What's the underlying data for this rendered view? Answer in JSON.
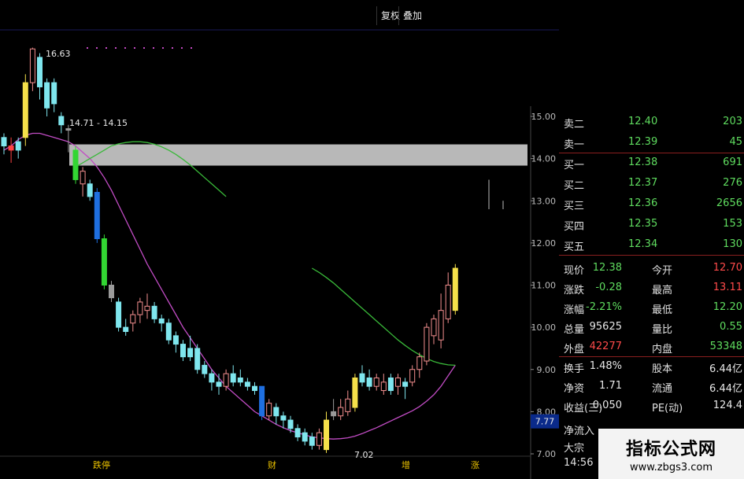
{
  "toolbar": {
    "fuquan_label": "复权",
    "diejia_label": "叠加"
  },
  "chart_data": {
    "type": "candlestick",
    "price_axis": {
      "ticks": [
        "15.00",
        "14.00",
        "13.00",
        "12.00",
        "11.00",
        "10.00",
        "9.00",
        "8.00",
        "7.00"
      ],
      "min": 6.8,
      "max": 15.2
    },
    "current_price_marker": "7.77",
    "annotations": {
      "high": "16.63",
      "zone": "14.71 - 14.15",
      "low": "7.02"
    },
    "resistance_zone": {
      "top": 14.71,
      "bottom": 14.15
    },
    "bottom_labels": [
      "跌停",
      "财",
      "增",
      "涨"
    ],
    "candles": [
      {
        "o": 14.3,
        "c": 14.5,
        "h": 14.6,
        "l": 14.1,
        "col": "cyan"
      },
      {
        "o": 14.2,
        "c": 14.3,
        "h": 14.5,
        "l": 13.9,
        "col": "red"
      },
      {
        "o": 14.4,
        "c": 14.2,
        "h": 14.5,
        "l": 14.0,
        "col": "cyan"
      },
      {
        "o": 14.5,
        "c": 15.8,
        "h": 16.0,
        "l": 14.3,
        "col": "yellow"
      },
      {
        "o": 15.8,
        "c": 16.6,
        "h": 16.63,
        "l": 15.6,
        "col": "pink"
      },
      {
        "o": 16.4,
        "c": 15.7,
        "h": 16.5,
        "l": 15.4,
        "col": "cyan"
      },
      {
        "o": 15.8,
        "c": 15.2,
        "h": 15.9,
        "l": 15.0,
        "col": "cyan"
      },
      {
        "o": 15.3,
        "c": 15.8,
        "h": 15.9,
        "l": 15.1,
        "col": "cyan"
      },
      {
        "o": 15.0,
        "c": 14.8,
        "h": 15.1,
        "l": 14.6,
        "col": "cyan"
      },
      {
        "o": 14.71,
        "c": 14.71,
        "h": 14.8,
        "l": 14.15,
        "col": "grey"
      },
      {
        "o": 14.2,
        "c": 13.5,
        "h": 14.3,
        "l": 13.4,
        "col": "green"
      },
      {
        "o": 13.4,
        "c": 13.7,
        "h": 13.8,
        "l": 13.1,
        "col": "pink"
      },
      {
        "o": 13.4,
        "c": 13.1,
        "h": 13.5,
        "l": 13.0,
        "col": "cyan"
      },
      {
        "o": 13.2,
        "c": 12.1,
        "h": 13.3,
        "l": 12.0,
        "col": "blue"
      },
      {
        "o": 12.1,
        "c": 11.0,
        "h": 12.2,
        "l": 10.9,
        "col": "green"
      },
      {
        "o": 11.0,
        "c": 10.7,
        "h": 11.1,
        "l": 10.6,
        "col": "grey"
      },
      {
        "o": 10.6,
        "c": 10.0,
        "h": 10.7,
        "l": 9.9,
        "col": "cyan"
      },
      {
        "o": 10.0,
        "c": 9.9,
        "h": 10.2,
        "l": 9.8,
        "col": "cyan"
      },
      {
        "o": 10.1,
        "c": 10.3,
        "h": 10.4,
        "l": 9.9,
        "col": "pink"
      },
      {
        "o": 10.3,
        "c": 10.6,
        "h": 10.7,
        "l": 10.1,
        "col": "pink"
      },
      {
        "o": 10.5,
        "c": 10.4,
        "h": 10.8,
        "l": 10.2,
        "col": "pink"
      },
      {
        "o": 10.5,
        "c": 10.2,
        "h": 10.6,
        "l": 10.1,
        "col": "cyan"
      },
      {
        "o": 10.2,
        "c": 10.1,
        "h": 10.3,
        "l": 9.9,
        "col": "cyan"
      },
      {
        "o": 10.1,
        "c": 9.7,
        "h": 10.2,
        "l": 9.6,
        "col": "cyan"
      },
      {
        "o": 9.8,
        "c": 9.6,
        "h": 9.9,
        "l": 9.4,
        "col": "cyan"
      },
      {
        "o": 9.6,
        "c": 9.3,
        "h": 9.7,
        "l": 9.2,
        "col": "cyan"
      },
      {
        "o": 9.5,
        "c": 9.3,
        "h": 9.8,
        "l": 9.2,
        "col": "cyan"
      },
      {
        "o": 9.5,
        "c": 9.0,
        "h": 9.6,
        "l": 8.9,
        "col": "cyan"
      },
      {
        "o": 9.1,
        "c": 8.9,
        "h": 9.2,
        "l": 8.8,
        "col": "cyan"
      },
      {
        "o": 8.9,
        "c": 8.7,
        "h": 9.0,
        "l": 8.5,
        "col": "cyan"
      },
      {
        "o": 8.7,
        "c": 8.6,
        "h": 8.9,
        "l": 8.4,
        "col": "cyan"
      },
      {
        "o": 8.6,
        "c": 8.9,
        "h": 9.0,
        "l": 8.5,
        "col": "pink"
      },
      {
        "o": 8.9,
        "c": 8.7,
        "h": 9.1,
        "l": 8.6,
        "col": "cyan"
      },
      {
        "o": 8.8,
        "c": 8.7,
        "h": 9.0,
        "l": 8.6,
        "col": "cyan"
      },
      {
        "o": 8.7,
        "c": 8.6,
        "h": 8.8,
        "l": 8.5,
        "col": "cyan"
      },
      {
        "o": 8.6,
        "c": 8.5,
        "h": 8.7,
        "l": 8.4,
        "col": "cyan"
      },
      {
        "o": 8.6,
        "c": 7.9,
        "h": 8.6,
        "l": 7.8,
        "col": "blue"
      },
      {
        "o": 7.9,
        "c": 8.2,
        "h": 8.3,
        "l": 7.8,
        "col": "pink"
      },
      {
        "o": 8.1,
        "c": 7.9,
        "h": 8.2,
        "l": 7.7,
        "col": "cyan"
      },
      {
        "o": 7.9,
        "c": 7.8,
        "h": 8.0,
        "l": 7.6,
        "col": "cyan"
      },
      {
        "o": 7.8,
        "c": 7.6,
        "h": 7.9,
        "l": 7.5,
        "col": "cyan"
      },
      {
        "o": 7.6,
        "c": 7.4,
        "h": 7.7,
        "l": 7.3,
        "col": "cyan"
      },
      {
        "o": 7.5,
        "c": 7.3,
        "h": 7.6,
        "l": 7.2,
        "col": "cyan"
      },
      {
        "o": 7.4,
        "c": 7.2,
        "h": 7.5,
        "l": 7.1,
        "col": "cyan"
      },
      {
        "o": 7.2,
        "c": 7.5,
        "h": 7.6,
        "l": 7.1,
        "col": "pink"
      },
      {
        "o": 7.1,
        "c": 7.8,
        "h": 8.0,
        "l": 7.02,
        "col": "yellow"
      },
      {
        "o": 7.9,
        "c": 8.0,
        "h": 8.3,
        "l": 7.8,
        "col": "grey"
      },
      {
        "o": 7.9,
        "c": 8.1,
        "h": 8.3,
        "l": 7.8,
        "col": "pink"
      },
      {
        "o": 8.0,
        "c": 8.3,
        "h": 8.5,
        "l": 7.9,
        "col": "pink"
      },
      {
        "o": 8.1,
        "c": 8.8,
        "h": 8.9,
        "l": 8.0,
        "col": "yellow"
      },
      {
        "o": 8.7,
        "c": 8.9,
        "h": 9.1,
        "l": 8.6,
        "col": "cyan"
      },
      {
        "o": 8.8,
        "c": 8.6,
        "h": 9.0,
        "l": 8.5,
        "col": "cyan"
      },
      {
        "o": 8.6,
        "c": 8.8,
        "h": 8.9,
        "l": 8.5,
        "col": "pink"
      },
      {
        "o": 8.7,
        "c": 8.5,
        "h": 8.9,
        "l": 8.4,
        "col": "pink"
      },
      {
        "o": 8.5,
        "c": 8.8,
        "h": 8.9,
        "l": 8.4,
        "col": "cyan"
      },
      {
        "o": 8.8,
        "c": 8.6,
        "h": 8.9,
        "l": 8.4,
        "col": "pink"
      },
      {
        "o": 8.6,
        "c": 8.7,
        "h": 8.8,
        "l": 8.3,
        "col": "cyan"
      },
      {
        "o": 8.7,
        "c": 9.0,
        "h": 9.1,
        "l": 8.6,
        "col": "pink"
      },
      {
        "o": 9.0,
        "c": 9.3,
        "h": 9.4,
        "l": 8.8,
        "col": "pink"
      },
      {
        "o": 9.2,
        "c": 10.0,
        "h": 10.1,
        "l": 9.1,
        "col": "pink"
      },
      {
        "o": 9.8,
        "c": 10.2,
        "h": 10.3,
        "l": 9.6,
        "col": "pink"
      },
      {
        "o": 9.7,
        "c": 10.4,
        "h": 10.8,
        "l": 9.5,
        "col": "pink"
      },
      {
        "o": 10.2,
        "c": 11.0,
        "h": 11.3,
        "l": 10.1,
        "col": "pink"
      },
      {
        "o": 10.4,
        "c": 11.4,
        "h": 11.5,
        "l": 10.3,
        "col": "yellow"
      }
    ],
    "ma_purple": [
      14.2,
      14.3,
      14.45,
      14.55,
      14.6,
      14.6,
      14.55,
      14.5,
      14.45,
      14.4,
      14.3,
      14.15,
      14.0,
      13.8,
      13.55,
      13.25,
      12.9,
      12.55,
      12.2,
      11.85,
      11.5,
      11.2,
      10.9,
      10.6,
      10.3,
      10.0,
      9.75,
      9.5,
      9.25,
      9.0,
      8.8,
      8.6,
      8.45,
      8.3,
      8.15,
      8.0,
      7.9,
      7.8,
      7.7,
      7.62,
      7.55,
      7.5,
      7.45,
      7.4,
      7.38,
      7.36,
      7.35,
      7.36,
      7.38,
      7.42,
      7.48,
      7.55,
      7.62,
      7.7,
      7.78,
      7.86,
      7.94,
      8.02,
      8.12,
      8.25,
      8.4,
      8.6,
      8.85,
      9.1
    ],
    "ma_green_1": [
      13.8,
      13.9,
      14.0,
      14.1,
      14.2,
      14.3,
      14.35,
      14.38,
      14.4,
      14.4,
      14.38,
      14.34,
      14.28,
      14.2,
      14.1,
      13.98,
      13.85,
      13.7,
      13.55,
      13.4,
      13.25,
      13.1
    ],
    "ma_green_2": [
      11.4,
      11.3,
      11.18,
      11.05,
      10.9,
      10.75,
      10.6,
      10.45,
      10.3,
      10.15,
      10.0,
      9.85,
      9.7,
      9.57,
      9.45,
      9.35,
      9.26,
      9.19,
      9.14,
      9.11,
      9.1
    ],
    "right_ticks": [
      12.8,
      13.5,
      12.8,
      13.0
    ]
  },
  "panel": {
    "order_book": [
      {
        "label": "卖二",
        "price": "12.40",
        "vol": "203"
      },
      {
        "label": "卖一",
        "price": "12.39",
        "vol": "45"
      },
      {
        "label": "买一",
        "price": "12.38",
        "vol": "691"
      },
      {
        "label": "买二",
        "price": "12.37",
        "vol": "276"
      },
      {
        "label": "买三",
        "price": "12.36",
        "vol": "2656"
      },
      {
        "label": "买四",
        "price": "12.35",
        "vol": "153"
      },
      {
        "label": "买五",
        "price": "12.34",
        "vol": "130"
      }
    ],
    "quotes": [
      {
        "l1": "现价",
        "v1": "12.38",
        "c1": "green",
        "l2": "今开",
        "v2": "12.70",
        "c2": "red"
      },
      {
        "l1": "涨跌",
        "v1": "-0.28",
        "c1": "green",
        "l2": "最高",
        "v2": "13.11",
        "c2": "red"
      },
      {
        "l1": "涨幅",
        "v1": "-2.21%",
        "c1": "green",
        "l2": "最低",
        "v2": "12.20",
        "c2": "green"
      },
      {
        "l1": "总量",
        "v1": "95625",
        "c1": "white",
        "l2": "量比",
        "v2": "0.55",
        "c2": "green"
      },
      {
        "l1": "外盘",
        "v1": "42277",
        "c1": "red",
        "l2": "内盘",
        "v2": "53348",
        "c2": "green"
      },
      {
        "l1": "换手",
        "v1": "1.48%",
        "c1": "white",
        "l2": "股本",
        "v2": "6.44亿",
        "c2": "white"
      },
      {
        "l1": "净资",
        "v1": "1.71",
        "c1": "white",
        "l2": "流通",
        "v2": "6.44亿",
        "c2": "white"
      },
      {
        "l1": "收益(三)",
        "v1": "0.050",
        "c1": "white",
        "l2": "PE(动)",
        "v2": "124.4",
        "c2": "white"
      }
    ],
    "extra": {
      "jingliu": "净流入",
      "dazong": "大宗",
      "time": "14:56"
    }
  },
  "watermark": {
    "title": "指标公式网",
    "url": "www.zbgs3.com"
  }
}
